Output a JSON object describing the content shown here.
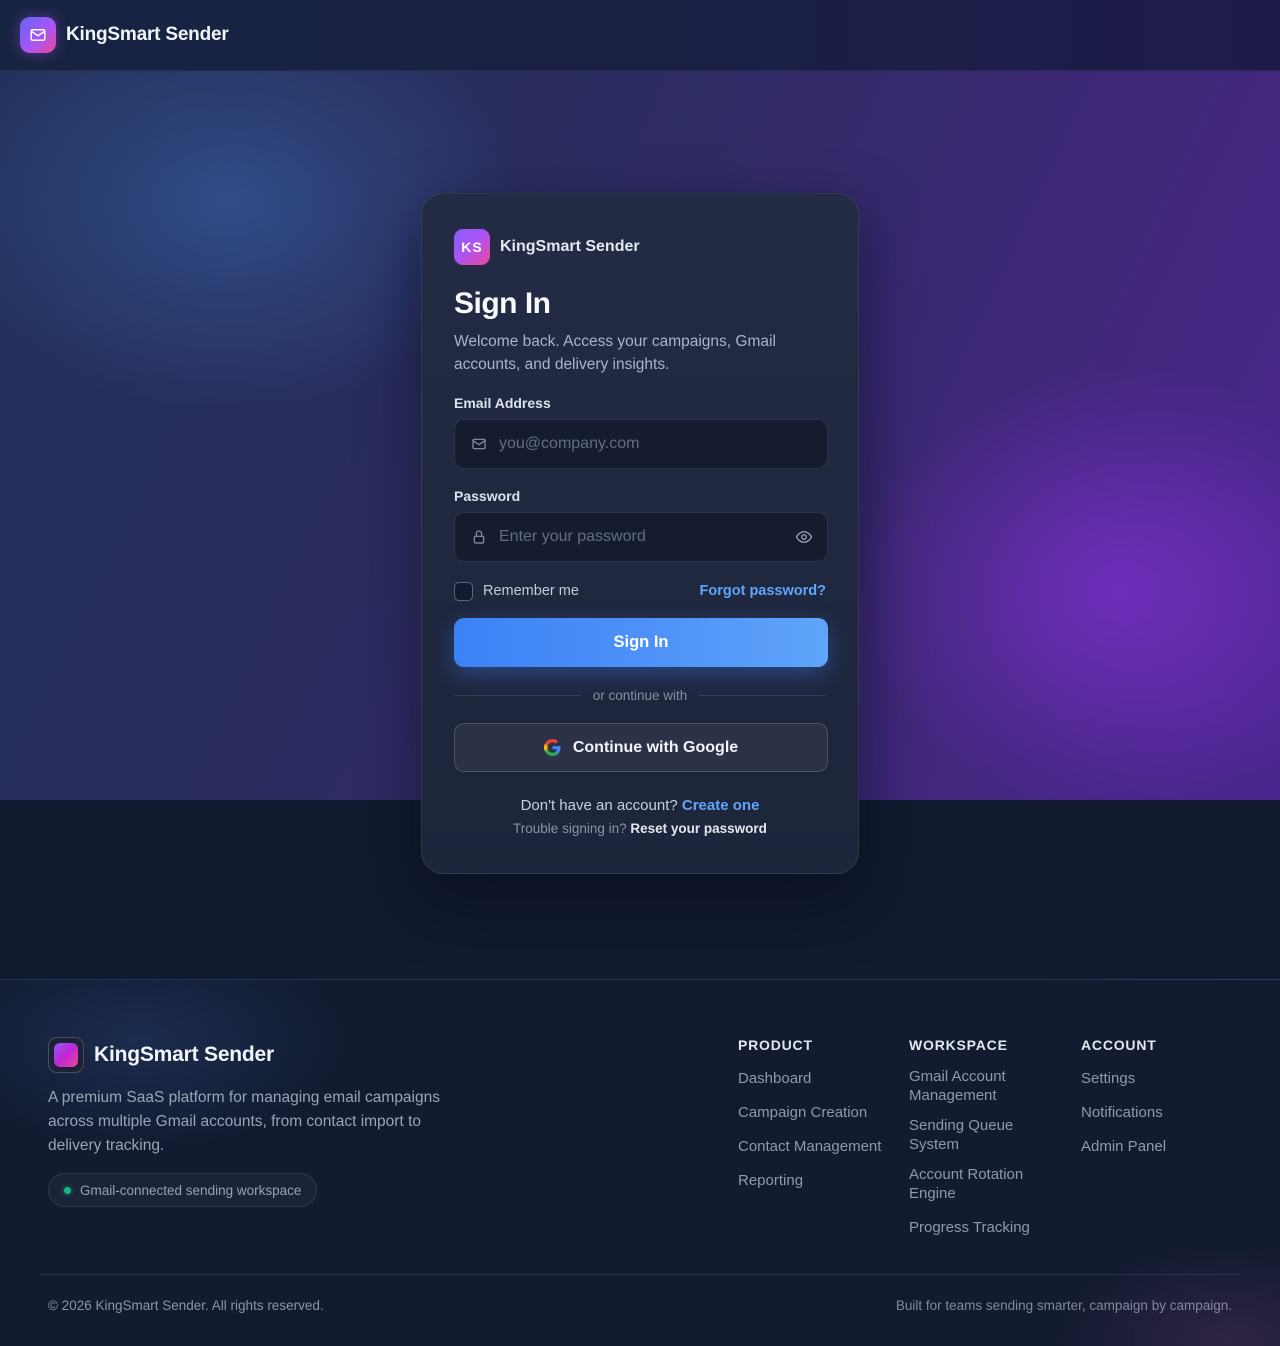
{
  "header": {
    "brand_name": "KingSmart Sender",
    "logo_icon": "mail-icon"
  },
  "card": {
    "badge_initials": "KS",
    "brand_name": "KingSmart Sender",
    "title": "Sign In",
    "subtitle": "Welcome back. Access your campaigns, Gmail accounts, and delivery insights.",
    "email": {
      "label": "Email Address",
      "placeholder": "you@company.com",
      "value": "",
      "icon": "mail-icon"
    },
    "password": {
      "label": "Password",
      "placeholder": "Enter your password",
      "value": "",
      "icon": "lock-icon",
      "toggle_icon": "eye-icon"
    },
    "remember_label": "Remember me",
    "remember_checked": false,
    "forgot_label": "Forgot password?",
    "signin_label": "Sign In",
    "divider_text": "or continue with",
    "google_label": "Continue with Google",
    "signup_prompt": "Don't have an account?",
    "signup_link": "Create one",
    "trouble_prompt": "Trouble signing in?",
    "trouble_link": "Reset your password"
  },
  "footer": {
    "brand_name": "KingSmart Sender",
    "description": "A premium SaaS platform for managing email campaigns across multiple Gmail accounts, from contact import to delivery tracking.",
    "pill_text": "Gmail-connected sending workspace",
    "columns": [
      {
        "title": "PRODUCT",
        "items": [
          "Dashboard",
          "Campaign Creation",
          "Contact Management",
          "Reporting"
        ]
      },
      {
        "title": "WORKSPACE",
        "items": [
          "Gmail Account Management",
          "Sending Queue System",
          "Account Rotation Engine",
          "Progress Tracking"
        ]
      },
      {
        "title": "ACCOUNT",
        "items": [
          "Settings",
          "Notifications",
          "Admin Panel"
        ]
      }
    ],
    "copyright": "© 2026 KingSmart Sender. All rights reserved.",
    "tagline": "Built for teams sending smarter, campaign by campaign."
  },
  "colors": {
    "accent": "#3b82f6",
    "link": "#60a5fa",
    "status_dot": "#10b981",
    "brand_gradient_start": "#8b5cf6",
    "brand_gradient_end": "#ec4899"
  }
}
